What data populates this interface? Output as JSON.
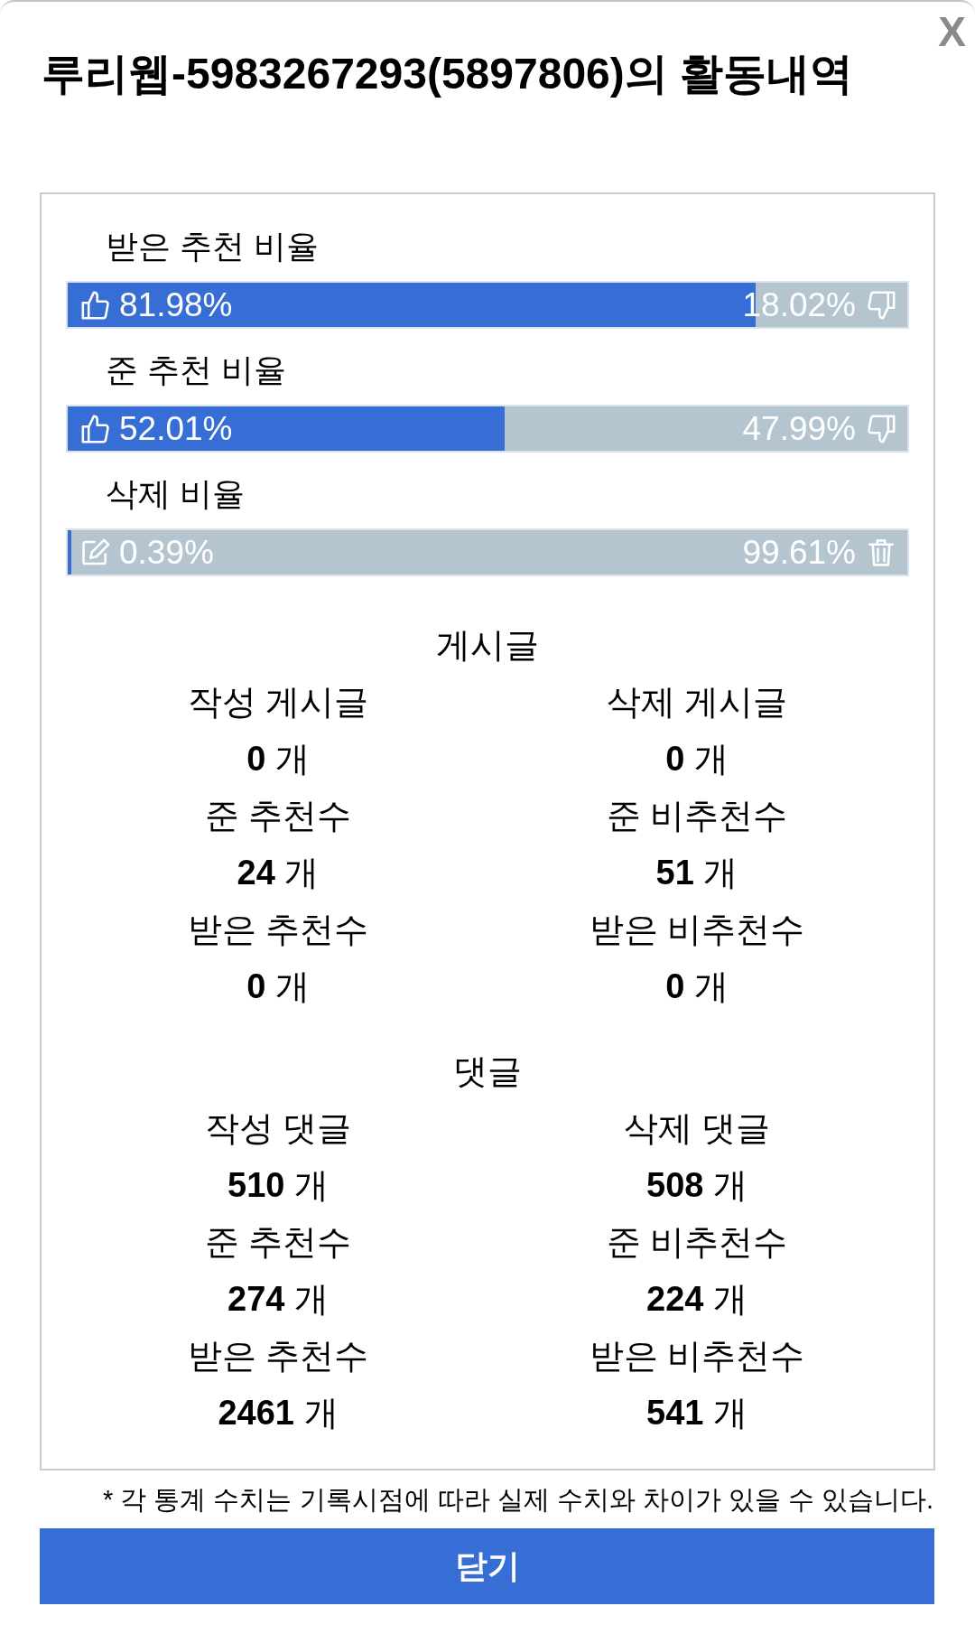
{
  "dialog": {
    "title": "루리웹-5983267293(5897806)의 활동내역",
    "close_button": "X"
  },
  "ratios": [
    {
      "kind": "vote",
      "label": "받은 추천 비율",
      "level": 0.8198,
      "left_value": "81.98%",
      "right_value": "18.02%"
    },
    {
      "kind": "vote",
      "label": "준 추천 비율",
      "level": 0.5201,
      "left_value": "52.01%",
      "right_value": "47.99%"
    },
    {
      "kind": "deletion",
      "label": "삭제 비율",
      "level": 0.0039,
      "left_value": "0.39%",
      "right_value": "99.61%"
    }
  ],
  "sections": [
    {
      "heading": "게시글",
      "stats": [
        {
          "label": "작성 게시글",
          "value": "**0** 개"
        },
        {
          "label": "삭제 게시글",
          "value": "**0** 개"
        },
        {
          "label": "준 추천수",
          "value": "**24** 개"
        },
        {
          "label": "준 비추천수",
          "value": "**51** 개"
        },
        {
          "label": "받은 추천수",
          "value": "**0** 개"
        },
        {
          "label": "받은 비추천수",
          "value": "**0** 개"
        }
      ]
    },
    {
      "heading": "댓글",
      "stats": [
        {
          "label": "작성 댓글",
          "value": "**510** 개"
        },
        {
          "label": "삭제 댓글",
          "value": "**508** 개"
        },
        {
          "label": "준 추천수",
          "value": "**274** 개"
        },
        {
          "label": "준 비추천수",
          "value": "**224** 개"
        },
        {
          "label": "받은 추천수",
          "value": "**2461** 개"
        },
        {
          "label": "받은 비추천수",
          "value": "**541** 개"
        }
      ]
    }
  ],
  "footnote": "* 각 통계 수치는 기록시점에 따라 실제 수치와 차이가 있을 수 있습니다.",
  "close_action": "닫기"
}
